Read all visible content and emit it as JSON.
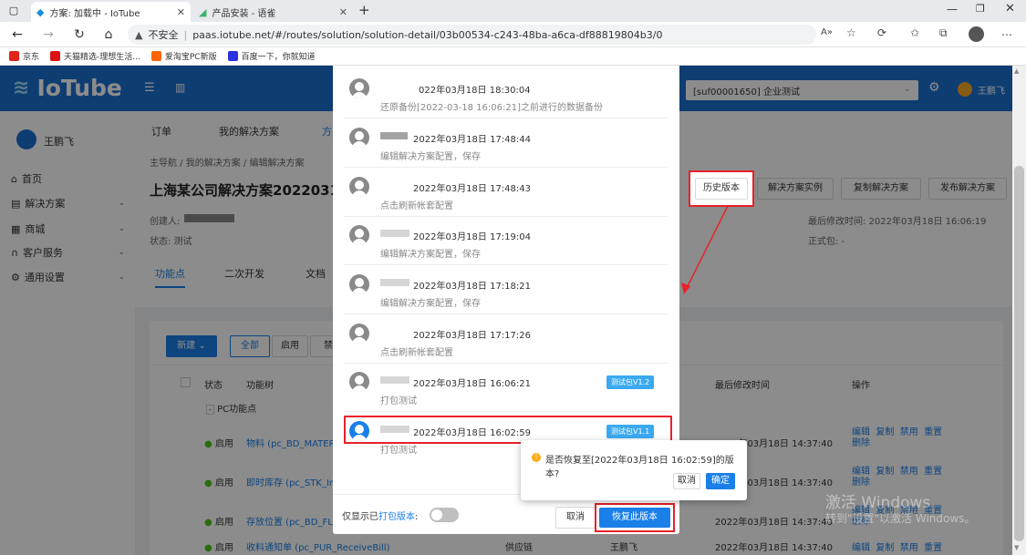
{
  "browser": {
    "tabs": [
      {
        "title": "方案: 加载中 - IoTube"
      },
      {
        "title": "产品安装 - 语雀"
      }
    ],
    "new_tab": "+",
    "security_label": "不安全",
    "url": "paas.iotube.net/#/routes/solution/solution-detail/03b00534-c243-48ba-a6ca-df88819804b3/0",
    "bookmarks": [
      "京东",
      "天猫精选-理想生活...",
      "爱淘宝PC新版",
      "百度一下，你就知道"
    ]
  },
  "app": {
    "logo": "IoTube",
    "tenant_select": "[suf00001650] 企业测试",
    "user": "王鹏飞",
    "sidebar": {
      "user": "王鹏飞",
      "items": [
        {
          "label": "首页",
          "chevron": false
        },
        {
          "label": "解决方案",
          "chevron": true
        },
        {
          "label": "商城",
          "chevron": true
        },
        {
          "label": "客户服务",
          "chevron": true
        },
        {
          "label": "通用设置",
          "chevron": true
        }
      ]
    },
    "top_tabs": [
      "订单",
      "我的解决方案",
      "方"
    ],
    "breadcrumb": [
      "主导航",
      "我的解决方案",
      "编辑解决方案"
    ],
    "solution_title": "上海某公司解决方案20220318",
    "creator_label": "创建人:",
    "status_label": "状态: 测试",
    "last_modified": "最后修改时间: 2022年03月18日 16:06:19",
    "official_pkg": "正式包: -",
    "action_buttons": [
      "历史版本",
      "解决方案实例",
      "复制解决方案",
      "发布解决方案"
    ],
    "content_tabs": [
      "功能点",
      "二次开发",
      "文档"
    ],
    "filter": {
      "new_btn": "新建",
      "all": "全部",
      "enabled": "启用",
      "disabled": "禁"
    },
    "table": {
      "headers": [
        "状态",
        "功能树",
        "最后修改时间",
        "操作"
      ],
      "group": "PC功能点",
      "rows": [
        {
          "status": "启用",
          "name": "物料 (pc_BD_MATER",
          "time": "2022年03月18日 14:37:40"
        },
        {
          "status": "启用",
          "name": "即时库存 (pc_STK_In",
          "time": "2022年03月18日 14:37:40"
        },
        {
          "status": "启用",
          "name": "存放位置 (pc_BD_FLE",
          "time": "2022年03月18日 14:37:40"
        },
        {
          "status": "启用",
          "name": "收料通知单 (pc_PUR_ReceiveBill)",
          "cat": "供应链",
          "owner": "王鹏飞",
          "time": "2022年03月18日 14:37:40"
        }
      ],
      "ops": [
        "编辑",
        "复制",
        "禁用",
        "重置",
        "删除"
      ]
    }
  },
  "history_modal": {
    "items": [
      {
        "time": "022年03月18日 18:30:04",
        "desc": "还原备份[2022-03-18 16:06:21]之前进行的数据备份",
        "badge": ""
      },
      {
        "time": "2022年03月18日 17:48:44",
        "desc": "编辑解决方案配置，保存",
        "badge": ""
      },
      {
        "time": "2022年03月18日 17:48:43",
        "desc": "点击刷新帐套配置",
        "badge": ""
      },
      {
        "time": "2022年03月18日 17:19:04",
        "desc": "编辑解决方案配置，保存",
        "badge": ""
      },
      {
        "time": "2022年03月18日 17:18:21",
        "desc": "编辑解决方案配置，保存",
        "badge": ""
      },
      {
        "time": "2022年03月18日 17:17:26",
        "desc": "点击刷新帐套配置",
        "badge": ""
      },
      {
        "time": "2022年03月18日 16:06:21",
        "desc": "打包测试",
        "badge": "测试包V1.2"
      },
      {
        "time": "2022年03月18日 16:02:59",
        "desc": "打包测试",
        "badge": "测试包V1.1"
      }
    ],
    "only_packaged_prefix": "仅显示已",
    "only_packaged_link": "打包版本",
    "only_packaged_suffix": ":",
    "cancel": "取消",
    "restore": "恢复此版本"
  },
  "popconfirm": {
    "message": "是否恢复至[2022年03月18日 16:02:59]的版本?",
    "cancel": "取消",
    "ok": "确定"
  },
  "watermark": {
    "line1": "激活 Windows",
    "line2": "转到\"设置\"以激活 Windows。"
  },
  "colors": {
    "brand": "#1a6fd0",
    "accent": "#1a7fe8",
    "annotation": "#e8212a",
    "badge": "#3ba9f0"
  }
}
